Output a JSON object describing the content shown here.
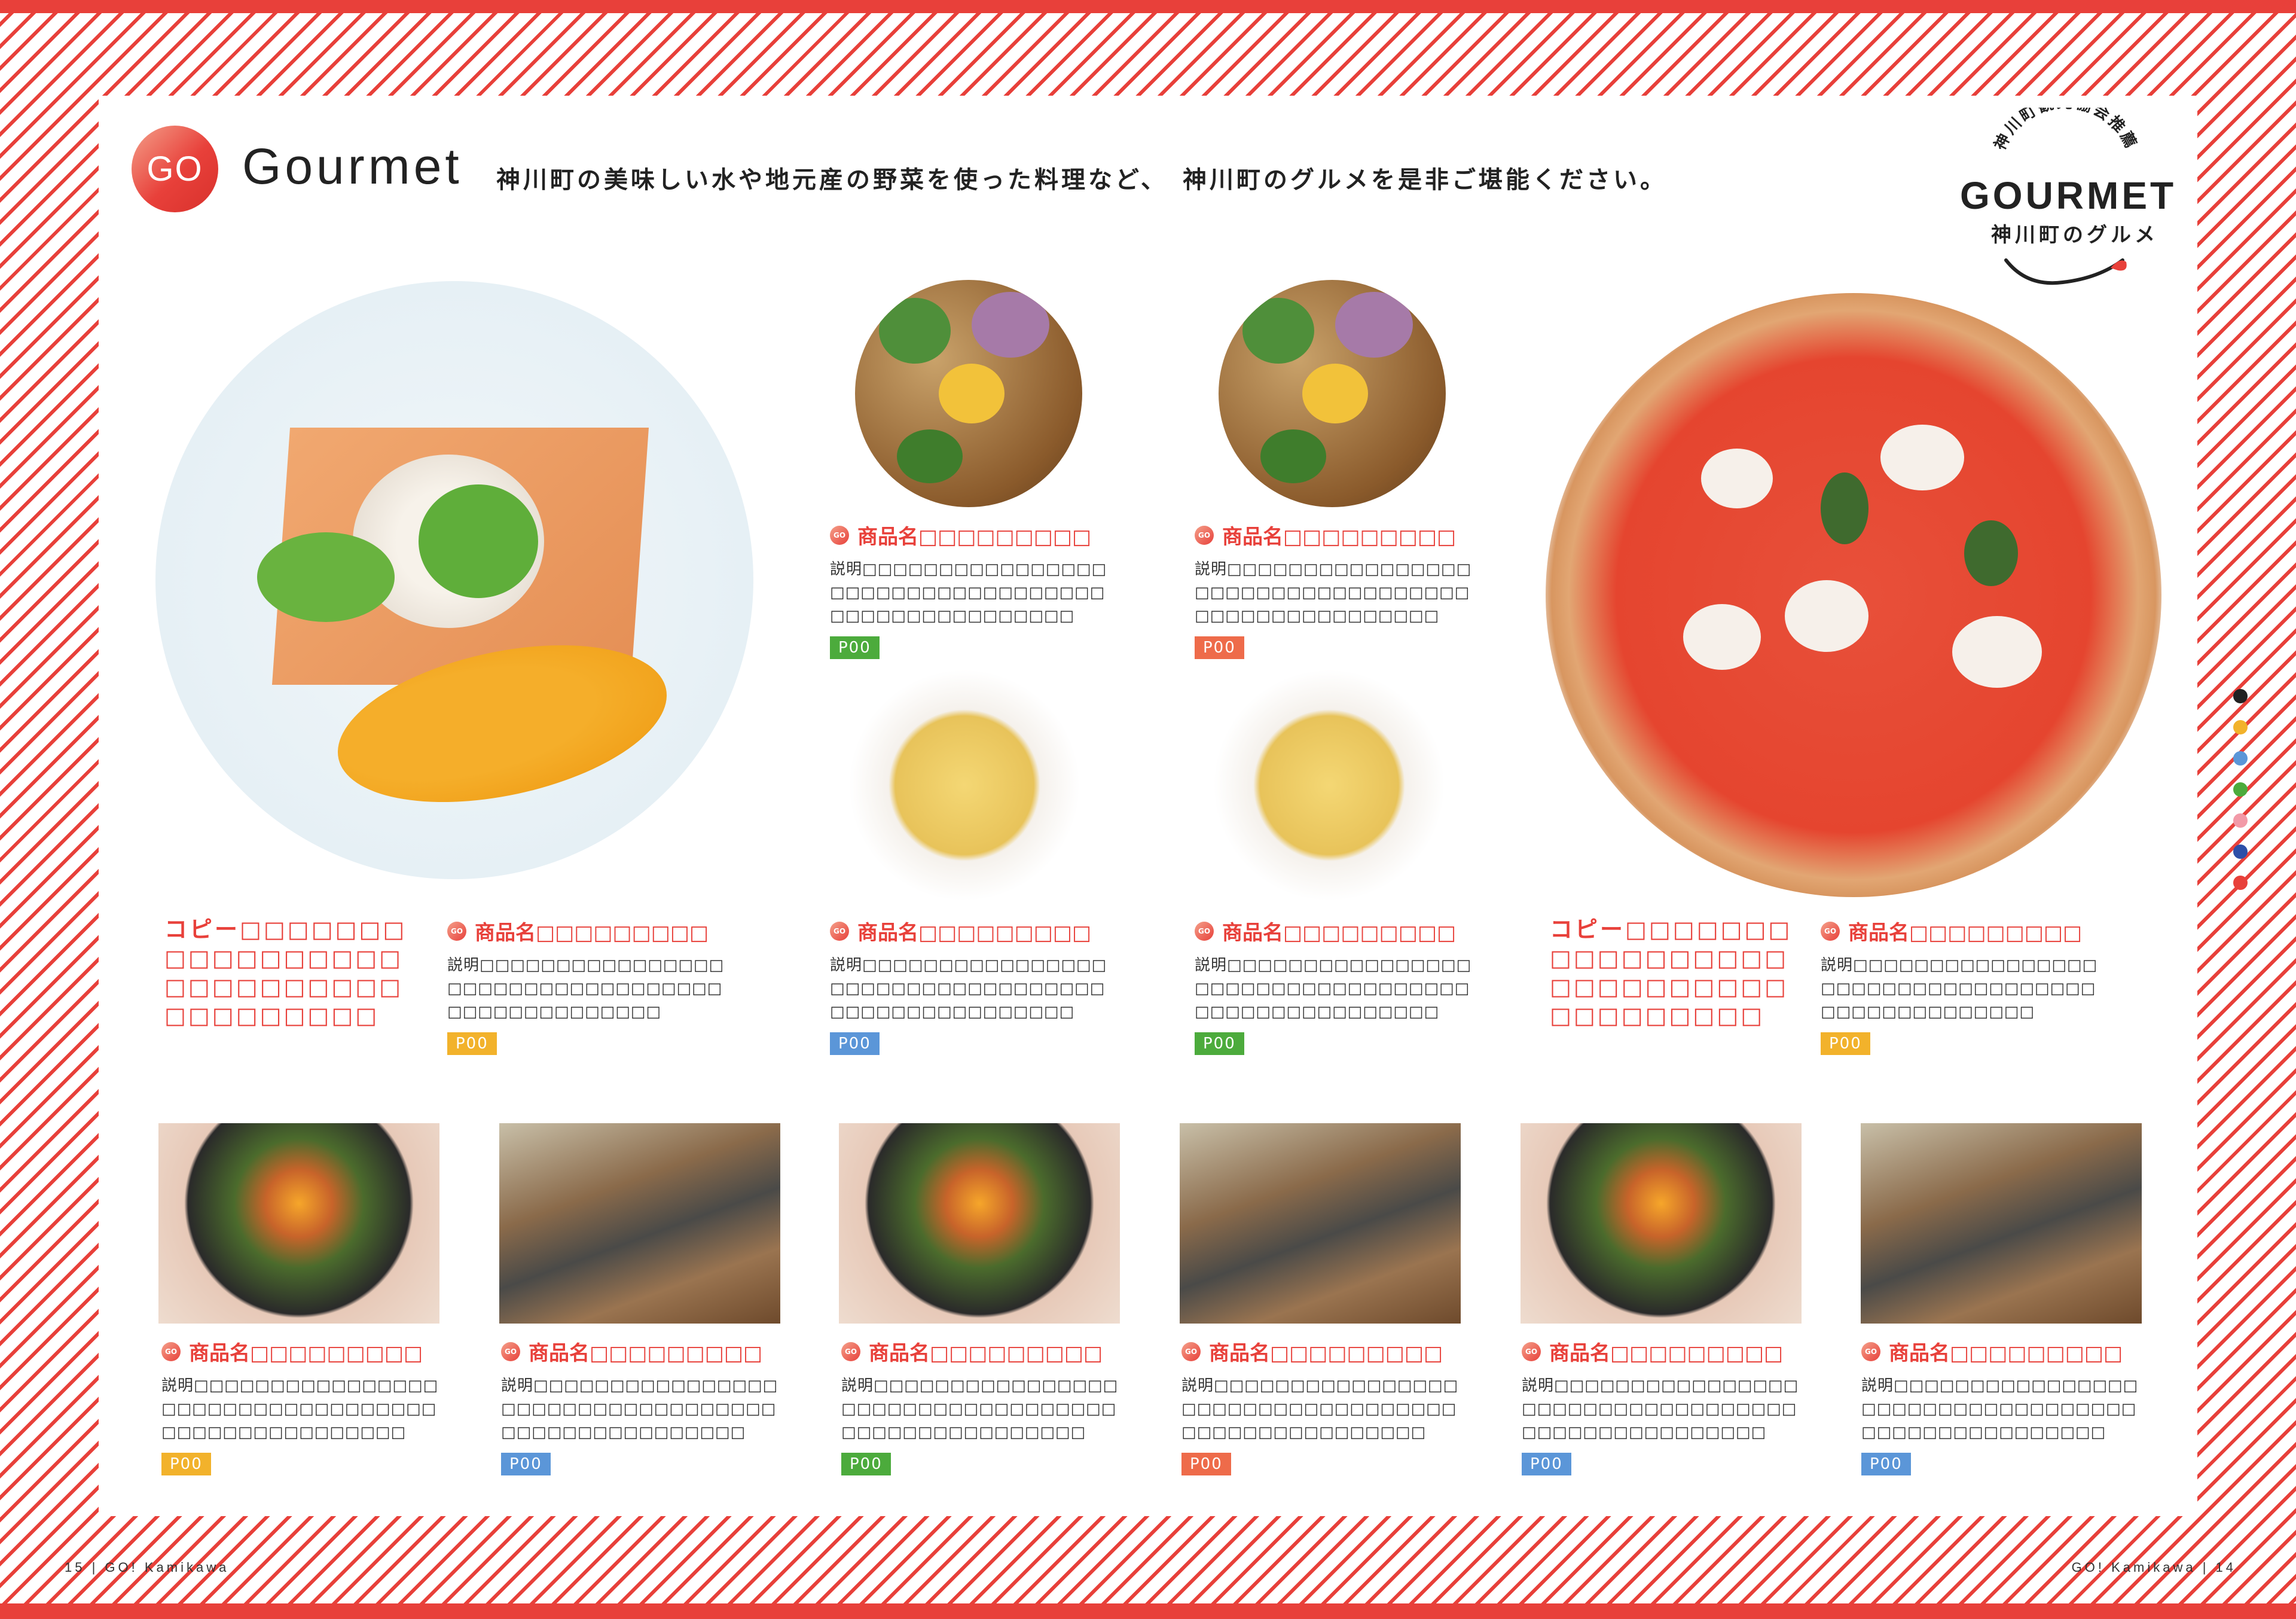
{
  "header": {
    "badge": "GO",
    "title": "Gourmet",
    "lead": "神川町の美味しい水や地元産の野菜を使った料理など、　神川町のグルメを是非ご堪能ください。"
  },
  "logo": {
    "arc_text": "神川町観光協会推薦",
    "main": "GOURMET",
    "sub": "神川町のグルメ"
  },
  "colors": {
    "accent": "#e8403a",
    "tag_green": "#4cab3c",
    "tag_orange": "#ee6b4a",
    "tag_yellow": "#f2b22b",
    "tag_blue": "#5b96d8"
  },
  "mini_badge": "GO",
  "copies": [
    {
      "text": "コピー□□□□□□□\n□□□□□□□□□□\n□□□□□□□□□□\n□□□□□□□□□"
    },
    {
      "text": "コピー□□□□□□□\n□□□□□□□□□□\n□□□□□□□□□□\n□□□□□□□□□"
    }
  ],
  "items": [
    {
      "name": "商品名□□□□□□□□□",
      "desc": "説明□□□□□□□□□□□□□□□□□□□□□□□□□□□□□□□□□□□□□□□□□□□□□□□□□□",
      "tag": "P00",
      "tag_color": "#4cab3c"
    },
    {
      "name": "商品名□□□□□□□□□",
      "desc": "説明□□□□□□□□□□□□□□□□□□□□□□□□□□□□□□□□□□□□□□□□□□□□□□□□□□",
      "tag": "P00",
      "tag_color": "#ee6b4a"
    },
    {
      "name": "商品名□□□□□□□□□",
      "desc": "説明□□□□□□□□□□□□□□□□□□□□□□□□□□□□□□□□□□□□□□□□□□□□□□□□",
      "tag": "P00",
      "tag_color": "#f2b22b"
    },
    {
      "name": "商品名□□□□□□□□□",
      "desc": "説明□□□□□□□□□□□□□□□□□□□□□□□□□□□□□□□□□□□□□□□□□□□□□□□□□□",
      "tag": "P00",
      "tag_color": "#5b96d8"
    },
    {
      "name": "商品名□□□□□□□□□",
      "desc": "説明□□□□□□□□□□□□□□□□□□□□□□□□□□□□□□□□□□□□□□□□□□□□□□□□□□",
      "tag": "P00",
      "tag_color": "#4cab3c"
    },
    {
      "name": "商品名□□□□□□□□□",
      "desc": "説明□□□□□□□□□□□□□□□□□□□□□□□□□□□□□□□□□□□□□□□□□□□□□□□□",
      "tag": "P00",
      "tag_color": "#f2b22b"
    },
    {
      "name": "商品名□□□□□□□□□",
      "desc": "説明□□□□□□□□□□□□□□□□□□□□□□□□□□□□□□□□□□□□□□□□□□□□□□□□□□",
      "tag": "P00",
      "tag_color": "#f2b22b"
    },
    {
      "name": "商品名□□□□□□□□□",
      "desc": "説明□□□□□□□□□□□□□□□□□□□□□□□□□□□□□□□□□□□□□□□□□□□□□□□□□□",
      "tag": "P00",
      "tag_color": "#5b96d8"
    },
    {
      "name": "商品名□□□□□□□□□",
      "desc": "説明□□□□□□□□□□□□□□□□□□□□□□□□□□□□□□□□□□□□□□□□□□□□□□□□□□",
      "tag": "P00",
      "tag_color": "#4cab3c"
    },
    {
      "name": "商品名□□□□□□□□□",
      "desc": "説明□□□□□□□□□□□□□□□□□□□□□□□□□□□□□□□□□□□□□□□□□□□□□□□□□□",
      "tag": "P00",
      "tag_color": "#ee6b4a"
    },
    {
      "name": "商品名□□□□□□□□□",
      "desc": "説明□□□□□□□□□□□□□□□□□□□□□□□□□□□□□□□□□□□□□□□□□□□□□□□□□□",
      "tag": "P00",
      "tag_color": "#5b96d8"
    },
    {
      "name": "商品名□□□□□□□□□",
      "desc": "説明□□□□□□□□□□□□□□□□□□□□□□□□□□□□□□□□□□□□□□□□□□□□□□□□□□",
      "tag": "P00",
      "tag_color": "#5b96d8"
    }
  ],
  "index_dots": [
    "#222222",
    "#f2b22b",
    "#5b96d8",
    "#4cab3c",
    "#f29aa8",
    "#2d4fa8",
    "#e8403a"
  ],
  "folio": {
    "left": "15 | GO! Kamikawa",
    "right": "GO! Kamikawa | 14"
  }
}
